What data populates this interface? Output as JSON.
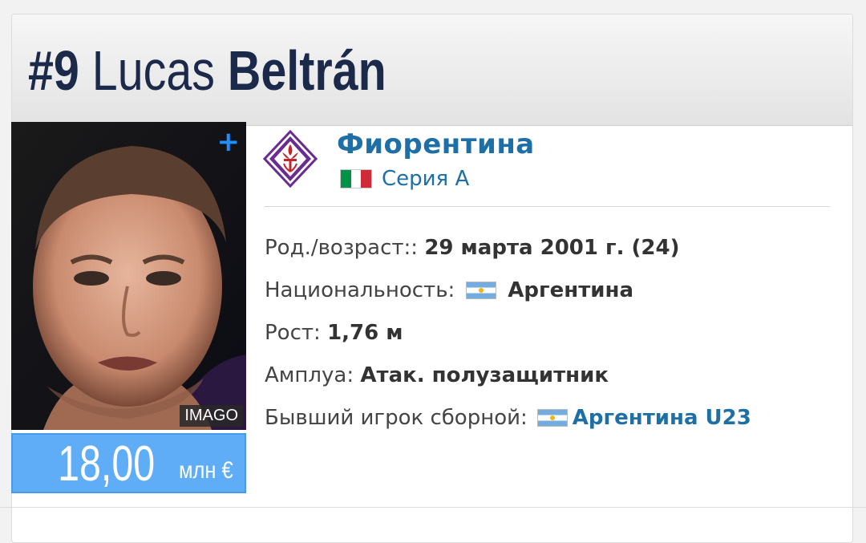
{
  "header": {
    "number": "#9",
    "first_name": "Lucas",
    "last_name": "Beltrán"
  },
  "photo": {
    "credit": "IMAGO",
    "expand_icon": "plus-icon",
    "expand_label": "+"
  },
  "market_value": {
    "amount": "18,00",
    "unit": "млн €",
    "color": "#5fadf7"
  },
  "club": {
    "name": "Фиорентина",
    "logo_icon": "fiorentina-crest-icon",
    "league": "Серия А",
    "league_flag_icon": "italy-flag-icon"
  },
  "info": {
    "birth_label": "Род./возраст::",
    "birth_value": "29 марта 2001 г. (24)",
    "nationality_label": "Национальность:",
    "nationality_value": "Аргентина",
    "height_label": "Рост:",
    "height_value": "1,76 м",
    "position_label": "Амплуа:",
    "position_value": "Атак. полузащитник",
    "former_intl_label": "Бывший игрок сборной:",
    "former_intl_value": "Аргентина U23"
  },
  "colors": {
    "title": "#1b2a4a",
    "link": "#1d6fa5",
    "accent_plus": "#1e90ff"
  }
}
